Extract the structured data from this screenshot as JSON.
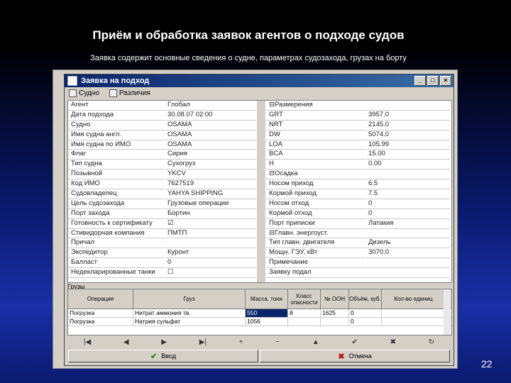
{
  "slide": {
    "title": "Приём и обработка заявок агентов о подходе судов",
    "subtitle": "Заявка содержит основные сведения о судне, параметрах судозахода, грузах на борту",
    "page_number": "22"
  },
  "window": {
    "title": "Заявка на подход",
    "menu": [
      "Судно",
      "Различия"
    ]
  },
  "left_props": [
    {
      "label": "Агент",
      "value": "Глобал"
    },
    {
      "label": "Дата подхода",
      "value": "30.08.07 02:00"
    },
    {
      "label": "Судно",
      "value": "OSAMA"
    },
    {
      "label": "Имя судна англ.",
      "value": "OSAMA"
    },
    {
      "label": "Имя судна по ИМО",
      "value": "OSAMA"
    },
    {
      "label": "Флаг",
      "value": "Сирия"
    },
    {
      "label": "Тип судна",
      "value": "Сухогруз"
    },
    {
      "label": "Позывной",
      "value": "YKCV"
    },
    {
      "label": "Код ИМО",
      "value": "7627519"
    },
    {
      "label": "Судовладелец",
      "value": "YAHYA SHIPPING"
    },
    {
      "label": "Цель судозахода",
      "value": "Грузовые операции"
    },
    {
      "label": "Порт захода",
      "value": "Бортин"
    },
    {
      "label": "Готовность к сертификату",
      "value": "☑"
    },
    {
      "label": "Стивидорная компания",
      "value": "ПМТП"
    },
    {
      "label": "Причал",
      "value": ""
    },
    {
      "label": "Экспедитор",
      "value": "Куронт"
    },
    {
      "label": "Балласт",
      "value": "0"
    },
    {
      "label": "Недекларированные танки",
      "value": "☐"
    }
  ],
  "right_props": [
    {
      "label": "⊟Размерения",
      "value": ""
    },
    {
      "label": "GRT",
      "value": "3957.0"
    },
    {
      "label": "NRT",
      "value": "2145.0"
    },
    {
      "label": "DW",
      "value": "5074.0"
    },
    {
      "label": "LOA",
      "value": "105.99"
    },
    {
      "label": "BCA",
      "value": "15.00"
    },
    {
      "label": "H",
      "value": "0.00"
    },
    {
      "label": "⊟Осадка",
      "value": ""
    },
    {
      "label": "Носом приход",
      "value": "6.5"
    },
    {
      "label": "Кормой приход",
      "value": "7.5"
    },
    {
      "label": "Носом отход",
      "value": "0"
    },
    {
      "label": "Кормой отход",
      "value": "0"
    },
    {
      "label": "Порт приписки",
      "value": "Латакия"
    },
    {
      "label": "⊟Главн. энергоуст.",
      "value": ""
    },
    {
      "label": "Тип главн. двигателя",
      "value": "Дизель"
    },
    {
      "label": "Мощн. ГЭУ, кВт",
      "value": "3070.0"
    },
    {
      "label": "Примечание",
      "value": ""
    },
    {
      "label": "Заявку подал",
      "value": ""
    }
  ],
  "grid": {
    "title": "Грузы",
    "headers": [
      "Операция",
      "Груз",
      "Масса, тонн",
      "Класс опасности",
      "№ ООН",
      "Объём, куб.",
      "Кол-во единиц"
    ],
    "rows": [
      [
        "Погрузка",
        "Нитрат аммония тв.",
        "550",
        "8",
        "1625",
        "0",
        ""
      ],
      [
        "Погрузка",
        "Натрия сульфат",
        "1056",
        "",
        "",
        "0",
        ""
      ]
    ]
  },
  "navigator": [
    "|◀",
    "◀",
    "▶",
    "▶|",
    "+",
    "−",
    "▲",
    "✔",
    "✖",
    "↻"
  ],
  "buttons": {
    "ok": "Ввод",
    "cancel": "Отмена"
  }
}
